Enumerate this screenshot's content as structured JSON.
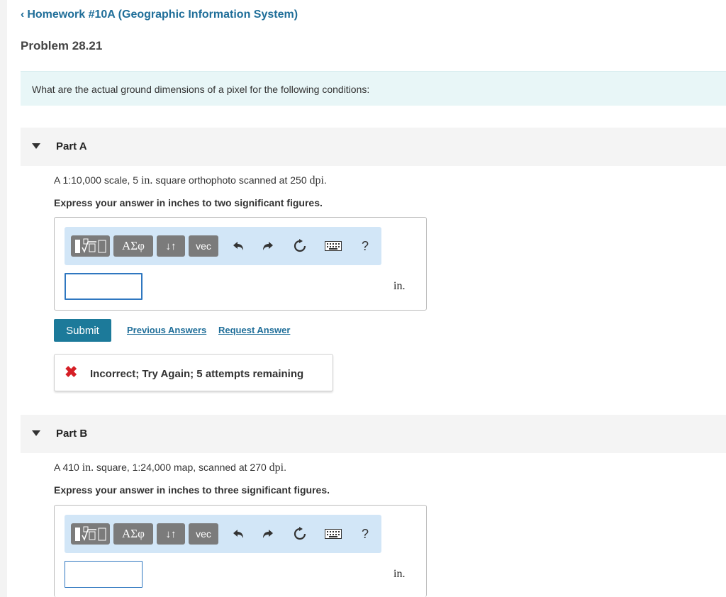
{
  "header": {
    "back_link": "Homework #10A (Geographic Information System)",
    "problem_title": "Problem 28.21"
  },
  "question": "What are the actual ground dimensions of a pixel for the following conditions:",
  "toolbar": {
    "greek_label": "ΑΣφ",
    "arrows_label": "↓↑",
    "vec_label": "vec",
    "help_label": "?"
  },
  "part_a": {
    "label": "Part A",
    "prompt_1": "A 1:10,000 scale, 5 ",
    "prompt_unit_1": "in.",
    "prompt_2": " square orthophoto scanned at 250 ",
    "prompt_unit_2": "dpi",
    "prompt_3": ".",
    "instruction": "Express your answer in inches to two significant figures.",
    "answer_value": "",
    "unit": "in.",
    "submit_label": "Submit",
    "previous_answers_label": "Previous Answers",
    "request_answer_label": "Request Answer",
    "feedback_icon": "✖",
    "feedback_text": "Incorrect; Try Again; 5 attempts remaining"
  },
  "part_b": {
    "label": "Part B",
    "prompt_1": "A 410 ",
    "prompt_unit_1": "in.",
    "prompt_2": " square, 1:24,000 map, scanned at 270 ",
    "prompt_unit_2": "dpi",
    "prompt_3": ".",
    "instruction": "Express your answer in inches to three significant figures.",
    "answer_value": "",
    "unit": "in."
  }
}
